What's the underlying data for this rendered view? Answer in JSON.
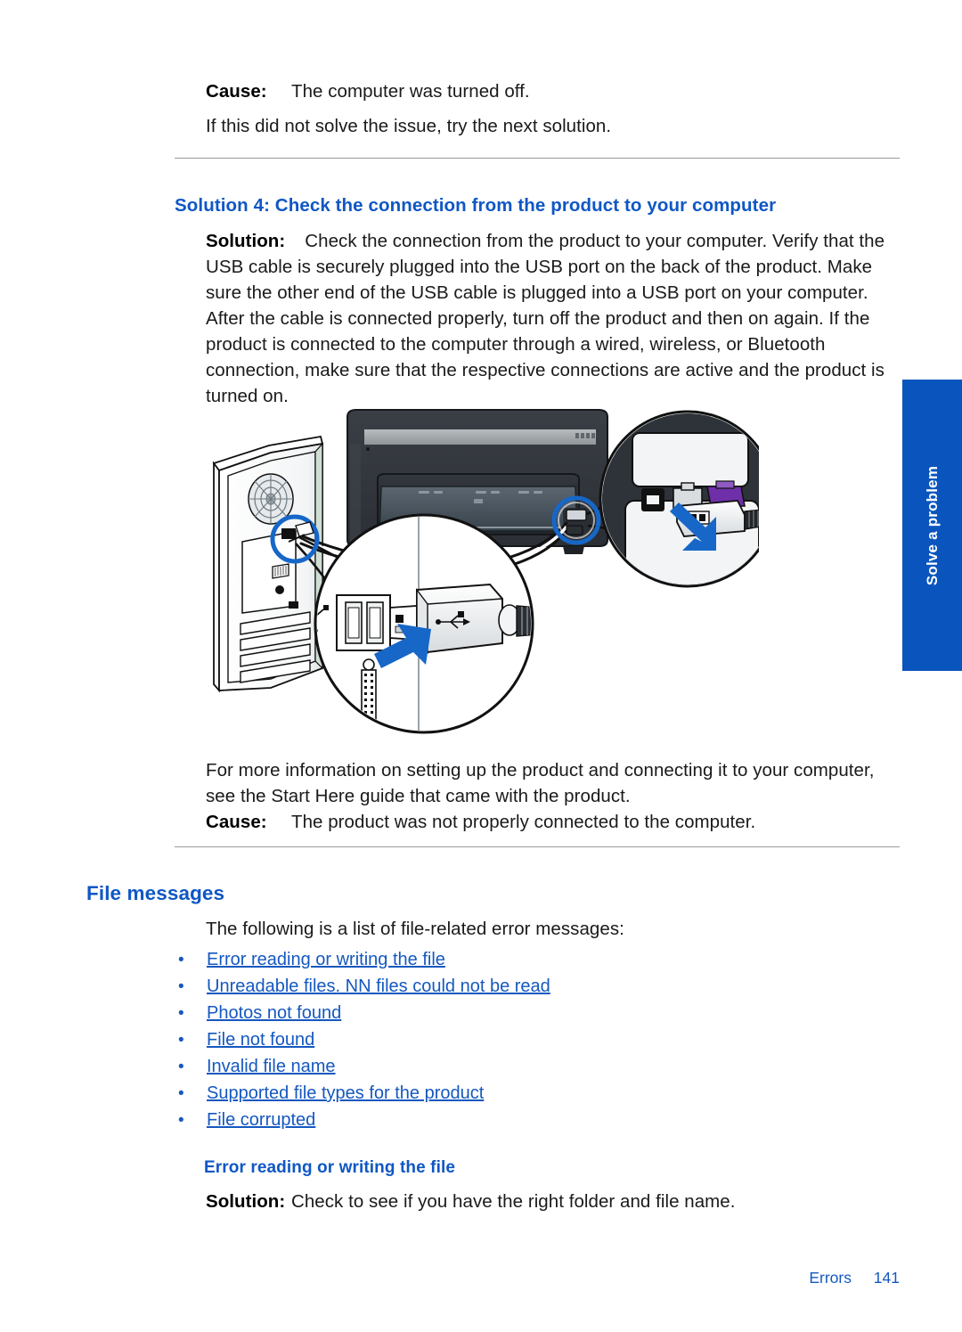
{
  "page": {
    "footer_label": "Errors",
    "footer_page": "141",
    "side_tab_label": "Solve a problem"
  },
  "colors": {
    "heading_blue": "#0f57c4",
    "link_blue": "#1558c0",
    "tab_blue": "#0a55bd",
    "rule_gray": "#9a9a9a"
  },
  "top_section": {
    "cause_label": "Cause:",
    "cause_text": "The computer was turned off.",
    "next_solution_text": "If this did not solve the issue, try the next solution."
  },
  "solution4": {
    "heading": "Solution 4: Check the connection from the product to your computer",
    "solution_label": "Solution:",
    "solution_text": "Check the connection from the product to your computer. Verify that the USB cable is securely plugged into the USB port on the back of the product. Make sure the other end of the USB cable is plugged into a USB port on your computer. After the cable is connected properly, turn off the product and then on again. If the product is connected to the computer through a wired, wireless, or Bluetooth connection, make sure that the respective connections are active and the product is turned on.",
    "more_info_text": "For more information on setting up the product and connecting it to your computer, see the Start Here guide that came with the product.",
    "cause_label": "Cause:",
    "cause_text": "The product was not properly connected to the computer."
  },
  "illustration": {
    "name": "usb-connection-diagram",
    "description": "Rear of printer connected by USB cable to a desktop computer tower, with two magnified circular callouts showing the USB port on the printer and the USB port on the computer."
  },
  "file_messages": {
    "heading": "File messages",
    "intro": "The following is a list of file-related error messages:",
    "links": [
      "Error reading or writing the file",
      "Unreadable files. NN files could not be read",
      "Photos not found",
      "File not found",
      "Invalid file name",
      "Supported file types for the product",
      "File corrupted"
    ]
  },
  "error_reading": {
    "heading": "Error reading or writing the file",
    "solution_label": "Solution:",
    "solution_text": "Check to see if you have the right folder and file name."
  }
}
